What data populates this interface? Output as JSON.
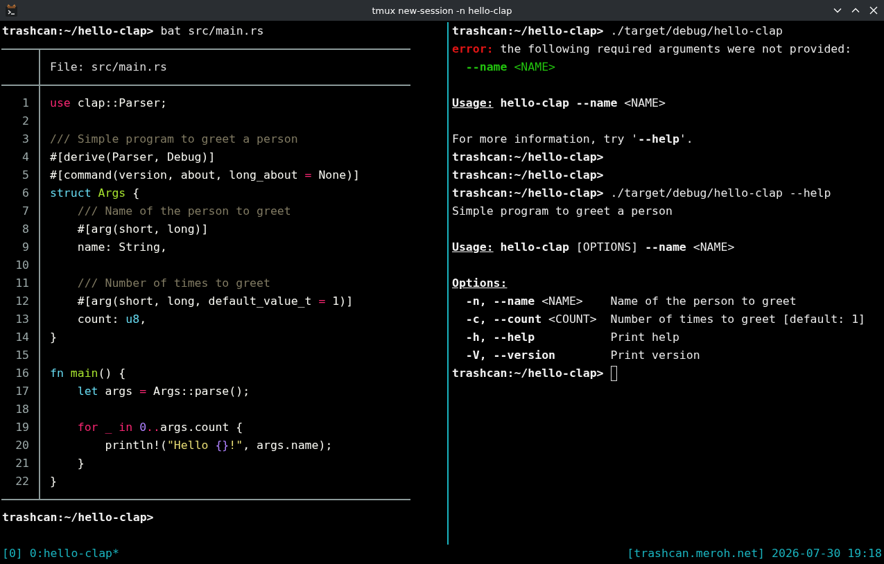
{
  "window": {
    "title": "tmux new-session -n hello-clap"
  },
  "left_pane": {
    "output_before": [
      {
        "kind": "text",
        "segments": [
          {
            "kind": "prompt",
            "text": "trashcan:~/hello-clap>"
          },
          {
            "kind": "plain",
            "text": " bat src/main.rs"
          }
        ]
      }
    ],
    "file_view": {
      "header": "File: src/main.rs",
      "rows": [
        {
          "number": "1",
          "tokens": [
            {
              "kind": "keyword",
              "text": "use"
            },
            {
              "kind": "plain",
              "text": " clap::Parser;"
            }
          ]
        },
        {
          "number": "2"
        },
        {
          "number": "3",
          "tokens": [
            {
              "kind": "comment",
              "text": "/// Simple program to greet a person"
            }
          ]
        },
        {
          "number": "4",
          "tokens": [
            {
              "kind": "plain",
              "text": "#[derive(Parser, Debug)]"
            }
          ]
        },
        {
          "number": "5",
          "tokens": [
            {
              "kind": "plain",
              "text": "#[command(version, about, long_about "
            },
            {
              "kind": "keyword",
              "text": "="
            },
            {
              "kind": "plain",
              "text": " None)]"
            }
          ]
        },
        {
          "number": "6",
          "tokens": [
            {
              "kind": "storage",
              "text": "struct"
            },
            {
              "kind": "entity",
              "text": " Args"
            },
            {
              "kind": "plain",
              "text": " {"
            }
          ]
        },
        {
          "number": "7",
          "tokens": [
            {
              "kind": "comment",
              "text": "    /// Name of the person to greet"
            }
          ]
        },
        {
          "number": "8",
          "tokens": [
            {
              "kind": "plain",
              "text": "    #[arg(short, long)]"
            }
          ]
        },
        {
          "number": "9",
          "tokens": [
            {
              "kind": "plain",
              "text": "    name: String,"
            }
          ]
        },
        {
          "number": "10"
        },
        {
          "number": "11",
          "tokens": [
            {
              "kind": "comment",
              "text": "    /// Number of times to greet"
            }
          ]
        },
        {
          "number": "12",
          "tokens": [
            {
              "kind": "plain",
              "text": "    #[arg(short, long, default_value_t "
            },
            {
              "kind": "keyword",
              "text": "="
            },
            {
              "kind": "plain",
              "text": " 1)]"
            }
          ]
        },
        {
          "number": "13",
          "tokens": [
            {
              "kind": "plain",
              "text": "    count: "
            },
            {
              "kind": "storage",
              "text": "u8"
            },
            {
              "kind": "plain",
              "text": ","
            }
          ]
        },
        {
          "number": "14",
          "tokens": [
            {
              "kind": "plain",
              "text": "}"
            }
          ]
        },
        {
          "number": "15"
        },
        {
          "number": "16",
          "tokens": [
            {
              "kind": "storage",
              "text": "fn"
            },
            {
              "kind": "entity",
              "text": " main"
            },
            {
              "kind": "plain",
              "text": "() {"
            }
          ]
        },
        {
          "number": "17",
          "tokens": [
            {
              "kind": "storage",
              "text": "    let"
            },
            {
              "kind": "plain",
              "text": " args "
            },
            {
              "kind": "keyword",
              "text": "="
            },
            {
              "kind": "plain",
              "text": " Args::parse();"
            }
          ]
        },
        {
          "number": "18"
        },
        {
          "number": "19",
          "tokens": [
            {
              "kind": "keyword",
              "text": "    for"
            },
            {
              "kind": "keyword",
              "text": " _"
            },
            {
              "kind": "keyword",
              "text": " in"
            },
            {
              "kind": "constant",
              "text": " 0"
            },
            {
              "kind": "keyword",
              "text": ".."
            },
            {
              "kind": "plain",
              "text": "args.count {"
            }
          ]
        },
        {
          "number": "20",
          "tokens": [
            {
              "kind": "plain",
              "text": "        println!("
            },
            {
              "kind": "string",
              "text": "\"Hello "
            },
            {
              "kind": "constant",
              "text": "{}"
            },
            {
              "kind": "string",
              "text": "!\""
            },
            {
              "kind": "plain",
              "text": ", args.name);"
            }
          ]
        },
        {
          "number": "21",
          "tokens": [
            {
              "kind": "plain",
              "text": "    }"
            }
          ]
        },
        {
          "number": "22",
          "tokens": [
            {
              "kind": "plain",
              "text": "}"
            }
          ]
        }
      ]
    },
    "output_after": [
      {
        "kind": "text",
        "segments": [
          {
            "kind": "prompt",
            "text": "trashcan:~/hello-clap>"
          }
        ]
      }
    ]
  },
  "right_pane": {
    "lines": [
      {
        "kind": "text",
        "segments": [
          {
            "kind": "prompt",
            "text": "trashcan:~/hello-clap>"
          },
          {
            "kind": "plain",
            "text": " ./target/debug/hello-clap"
          }
        ]
      },
      {
        "kind": "text",
        "segments": [
          {
            "kind": "error",
            "text": "error:"
          },
          {
            "kind": "plain",
            "text": " the following required arguments were not provided:"
          }
        ]
      },
      {
        "kind": "text",
        "segments": [
          {
            "kind": "flag",
            "text": "  --name"
          },
          {
            "kind": "value",
            "text": " <NAME>"
          }
        ]
      },
      {
        "kind": "blank"
      },
      {
        "kind": "text",
        "segments": [
          {
            "kind": "heading",
            "text": "Usage:"
          },
          {
            "kind": "bold",
            "text": " hello-clap --name"
          },
          {
            "kind": "plain",
            "text": " <NAME>"
          }
        ]
      },
      {
        "kind": "blank"
      },
      {
        "kind": "text",
        "segments": [
          {
            "kind": "plain",
            "text": "For more information, try '"
          },
          {
            "kind": "bold",
            "text": "--help"
          },
          {
            "kind": "plain",
            "text": "'."
          }
        ]
      },
      {
        "kind": "text",
        "segments": [
          {
            "kind": "prompt",
            "text": "trashcan:~/hello-clap>"
          }
        ]
      },
      {
        "kind": "text",
        "segments": [
          {
            "kind": "prompt",
            "text": "trashcan:~/hello-clap>"
          }
        ]
      },
      {
        "kind": "text",
        "segments": [
          {
            "kind": "prompt",
            "text": "trashcan:~/hello-clap>"
          },
          {
            "kind": "plain",
            "text": " ./target/debug/hello-clap --help"
          }
        ]
      },
      {
        "kind": "text",
        "segments": [
          {
            "kind": "plain",
            "text": "Simple program to greet a person"
          }
        ]
      },
      {
        "kind": "blank"
      },
      {
        "kind": "text",
        "segments": [
          {
            "kind": "heading",
            "text": "Usage:"
          },
          {
            "kind": "bold",
            "text": " hello-clap"
          },
          {
            "kind": "plain",
            "text": " [OPTIONS] "
          },
          {
            "kind": "bold",
            "text": "--name"
          },
          {
            "kind": "plain",
            "text": " <NAME>"
          }
        ]
      },
      {
        "kind": "blank"
      },
      {
        "kind": "text",
        "segments": [
          {
            "kind": "heading",
            "text": "Options:"
          }
        ]
      },
      {
        "kind": "text",
        "segments": [
          {
            "kind": "bold",
            "text": "  -n, --name"
          },
          {
            "kind": "plain",
            "text": " <NAME>    Name of the person to greet"
          }
        ]
      },
      {
        "kind": "text",
        "segments": [
          {
            "kind": "bold",
            "text": "  -c, --count"
          },
          {
            "kind": "plain",
            "text": " <COUNT>  Number of times to greet [default: 1]"
          }
        ]
      },
      {
        "kind": "text",
        "segments": [
          {
            "kind": "bold",
            "text": "  -h, --help"
          },
          {
            "kind": "plain",
            "text": "           Print help"
          }
        ]
      },
      {
        "kind": "text",
        "segments": [
          {
            "kind": "bold",
            "text": "  -V, --version"
          },
          {
            "kind": "plain",
            "text": "        Print version"
          }
        ]
      },
      {
        "kind": "input",
        "segments": [
          {
            "kind": "prompt",
            "text": "trashcan:~/hello-clap>"
          }
        ]
      }
    ]
  },
  "status_bar": {
    "session": "[0]",
    "window": "0:hello-clap*",
    "host": "[trashcan.meroh.net]",
    "clock": "2026-07-30 19:18"
  }
}
